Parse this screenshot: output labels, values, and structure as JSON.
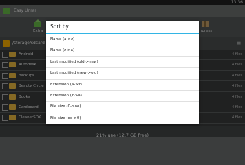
{
  "status_bar": {
    "time": "13:36"
  },
  "app": {
    "title": "Easy Unrar"
  },
  "toolbar": {
    "extract_label": "Extra",
    "compress_label": "mpress"
  },
  "path": {
    "current": "/storage/sdcard"
  },
  "files": [
    {
      "name": "Android",
      "count": "4 files"
    },
    {
      "name": "Autodesk",
      "count": "4 files"
    },
    {
      "name": "backups",
      "count": "4 files"
    },
    {
      "name": "Beauty Circle",
      "count": "4 files"
    },
    {
      "name": "Books",
      "count": "4 files"
    },
    {
      "name": "Cardboard",
      "count": "4 files"
    },
    {
      "name": "CleanerSDK",
      "count": "4 files"
    },
    {
      "name": "...",
      "count": ""
    }
  ],
  "footer": {
    "usage": "21% use (12,7 GB free)"
  },
  "dialog": {
    "title": "Sort by",
    "options": [
      "Name (a->z)",
      "Name (z->a)",
      "Last modified (old->new)",
      "Last modified (new->old)",
      "Extension (a->z)",
      "Extension (z->a)",
      "File size (0->oo)",
      "File size (oo->0)"
    ]
  },
  "colors": {
    "accent": "#33b5e5",
    "folder": "#f2c043",
    "app_icon": "#6ac04a"
  }
}
